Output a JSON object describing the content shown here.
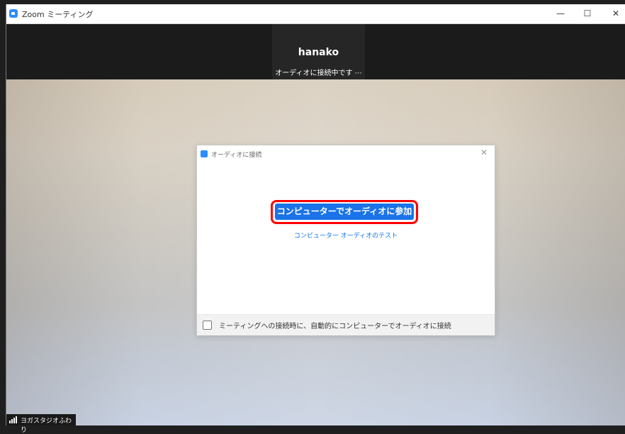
{
  "window": {
    "title": "Zoom ミーティング",
    "controls": {
      "minimize": "—",
      "maximize": "☐",
      "close": "✕"
    }
  },
  "participant": {
    "name": "hanako",
    "status": "オーディオに接続中です ⋯"
  },
  "dialog": {
    "title": "オーディオに接続",
    "close": "✕",
    "join_button": "コンピューターでオーディオに参加",
    "test_link": "コンピューター オーディオのテスト",
    "auto_join_label": "ミーティングへの接続時に、自動的にコンピューターでオーディオに接続",
    "auto_join_checked": false
  },
  "status": {
    "label": "ヨガスタジオふわり"
  },
  "colors": {
    "accent": "#2D8CFF",
    "button": "#1A73E8",
    "highlight": "#FF0000"
  }
}
